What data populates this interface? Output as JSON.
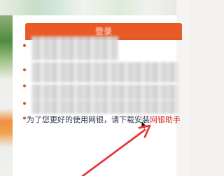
{
  "header": {
    "title": "登录"
  },
  "notice": {
    "prefix": "为了您更好的使用网银，请下载安装",
    "link": "网银助手"
  },
  "colors": {
    "accent": "#e95a25",
    "link": "#d62d2a",
    "arrow": "#e53a3a"
  },
  "icons": {
    "cursor": "pointer-icon",
    "arrow": "annotation-arrow-icon"
  }
}
